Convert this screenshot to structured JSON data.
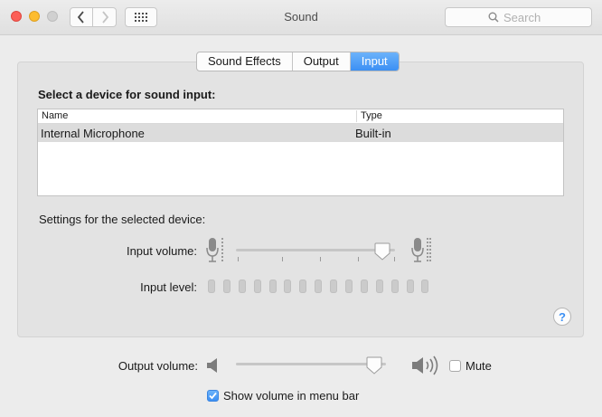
{
  "window": {
    "title": "Sound"
  },
  "toolbar": {
    "search_placeholder": "Search"
  },
  "tabs": [
    {
      "label": "Sound Effects",
      "active": false
    },
    {
      "label": "Output",
      "active": false
    },
    {
      "label": "Input",
      "active": true
    }
  ],
  "input_tab": {
    "heading": "Select a device for sound input:",
    "table": {
      "columns": [
        "Name",
        "Type"
      ],
      "rows": [
        {
          "name": "Internal Microphone",
          "type": "Built-in",
          "selected": true
        }
      ]
    },
    "settings_label": "Settings for the selected device:",
    "input_volume_label": "Input volume:",
    "input_volume_level": 0.92,
    "input_level_label": "Input level:",
    "input_level_segments_lit": 0,
    "input_level_segments_total": 15
  },
  "output": {
    "volume_label": "Output volume:",
    "volume_level": 0.92,
    "mute_label": "Mute",
    "mute_checked": false,
    "show_volume_label": "Show volume in menu bar",
    "show_volume_checked": true
  },
  "icons": {
    "close": "close-icon",
    "minimize": "minimize-icon",
    "zoom": "zoom-icon",
    "back": "chevron-left-icon",
    "forward": "chevron-right-icon",
    "grid": "grid-icon",
    "search": "search-icon",
    "mic_low": "microphone-low-icon",
    "mic_high": "microphone-high-icon",
    "speaker_low": "speaker-low-icon",
    "speaker_high": "speaker-high-icon",
    "help": "question-icon"
  },
  "colors": {
    "accent": "#3b8ff4",
    "close": "#fc5f57",
    "minimize": "#fdbc2e"
  }
}
